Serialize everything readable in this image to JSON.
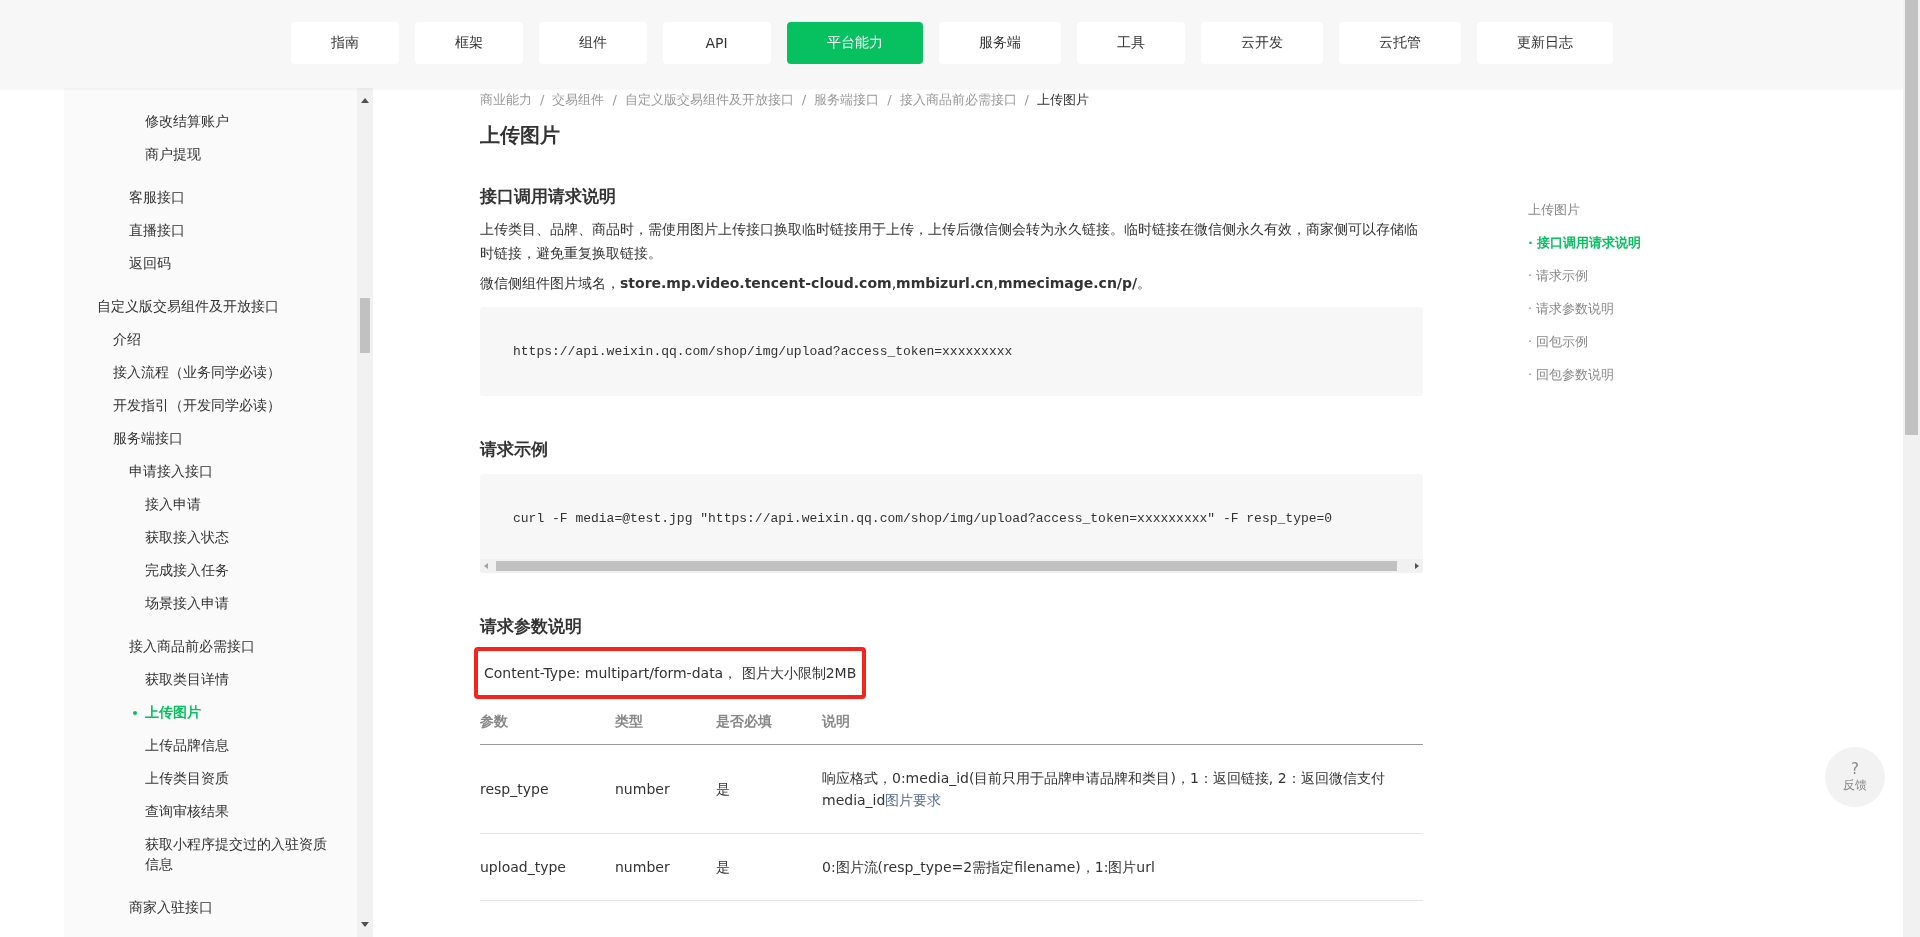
{
  "nav": {
    "tabs": [
      {
        "label": "指南",
        "selected": false
      },
      {
        "label": "框架",
        "selected": false
      },
      {
        "label": "组件",
        "selected": false
      },
      {
        "label": "API",
        "selected": false
      },
      {
        "label": "平台能力",
        "selected": true
      },
      {
        "label": "服务端",
        "selected": false
      },
      {
        "label": "工具",
        "selected": false
      },
      {
        "label": "云开发",
        "selected": false
      },
      {
        "label": "云托管",
        "selected": false
      },
      {
        "label": "更新日志",
        "selected": false
      }
    ]
  },
  "sidebar": {
    "items": [
      {
        "children": [
          {
            "children": [
              {
                "children": [
                  {
                    "label": "修改结算账户",
                    "selected": false
                  },
                  {
                    "label": "商户提现",
                    "selected": false
                  }
                ]
              },
              {
                "label": "客服接口",
                "selected": false
              },
              {
                "label": "直播接口",
                "selected": false
              },
              {
                "label": "返回码",
                "selected": false
              }
            ]
          }
        ]
      },
      {
        "label": "自定义版交易组件及开放接口",
        "selected": false,
        "children": [
          {
            "label": "介绍",
            "selected": false
          },
          {
            "label": "接入流程（业务同学必读）",
            "selected": false
          },
          {
            "label": "开发指引（开发同学必读）",
            "selected": false
          },
          {
            "label": "服务端接口",
            "selected": false,
            "children": [
              {
                "label": "申请接入接口",
                "selected": false,
                "children": [
                  {
                    "label": "接入申请",
                    "selected": false
                  },
                  {
                    "label": "获取接入状态",
                    "selected": false
                  },
                  {
                    "label": "完成接入任务",
                    "selected": false
                  },
                  {
                    "label": "场景接入申请",
                    "selected": false
                  }
                ]
              },
              {
                "label": "接入商品前必需接口",
                "selected": false,
                "children": [
                  {
                    "label": "获取类目详情",
                    "selected": false
                  },
                  {
                    "label": "上传图片",
                    "selected": true
                  },
                  {
                    "label": "上传品牌信息",
                    "selected": false
                  },
                  {
                    "label": "上传类目资质",
                    "selected": false
                  },
                  {
                    "label": "查询审核结果",
                    "selected": false
                  },
                  {
                    "label": "获取小程序提交过的入驻资质信息",
                    "selected": false
                  }
                ]
              },
              {
                "label": "商家入驻接口",
                "selected": false
              }
            ]
          }
        ]
      }
    ]
  },
  "breadcrumb": {
    "separator": "/",
    "links": [
      "商业能力",
      "交易组件",
      "自定义版交易组件及开放接口",
      "服务端接口",
      "接入商品前必需接口",
      "上传图片"
    ]
  },
  "title": "上传图片",
  "sections": [
    {
      "heading": "接口调用请求说明",
      "paragraphs": [
        "上传类目、品牌、商品时，需使用图片上传接口换取临时链接用于上传，上传后微信侧会转为永久链接。临时链接在微信侧永久有效，商家侧可以存储临时链接，避免重复换取链接。",
        "微信侧组件图片域名，**store.mp.video.tencent-cloud.com**,**mmbizurl.cn**,**mmecimage.cn/p/**。"
      ],
      "code": "https://api.weixin.qq.com/shop/img/upload?access_token=xxxxxxxxx"
    },
    {
      "heading": "请求示例",
      "code": "curl -F media=@test.jpg \"https://api.weixin.qq.com/shop/img/upload?access_token=xxxxxxxxx\" -F resp_type=0",
      "scrollable": true
    },
    {
      "heading": "请求参数说明",
      "note": "Content-Type: multipart/form-data， 图片大小限制2MB",
      "highlighted": true
    }
  ],
  "table": {
    "columns": [
      "参数",
      "类型",
      "是否必填",
      "说明"
    ],
    "rows": [
      {
        "cells": [
          "resp_type",
          "number",
          "是",
          "响应格式，0:media_id(目前只用于品牌申请品牌和类目)，1：返回链接, 2：返回微信支付media_id"
        ],
        "link": "图片要求"
      },
      {
        "cells": [
          "upload_type",
          "number",
          "是",
          "0:图片流(resp_type=2需指定filename)，1:图片url"
        ]
      }
    ]
  },
  "toc": {
    "title": "上传图片",
    "items": [
      {
        "label": "· 接口调用请求说明",
        "selected": true
      },
      {
        "label": "· 请求示例",
        "selected": false
      },
      {
        "label": "· 请求参数说明",
        "selected": false
      },
      {
        "label": "· 回包示例",
        "selected": false
      },
      {
        "label": "· 回包参数说明",
        "selected": false
      }
    ]
  },
  "feedback": {
    "icon": "?",
    "label": "反馈"
  }
}
